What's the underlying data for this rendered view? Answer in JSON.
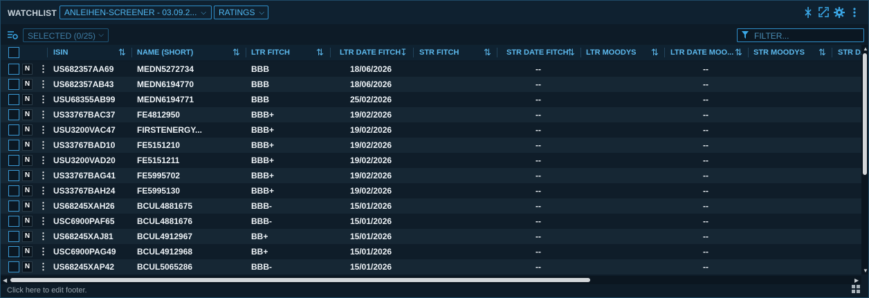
{
  "header": {
    "title": "WATCHLIST",
    "screener_dropdown": "ANLEIHEN-SCREENER - 03.09.2...",
    "view_dropdown": "RATINGS",
    "icons": [
      "pin-icon",
      "expand-icon",
      "gear-icon",
      "more-icon"
    ]
  },
  "toolbar": {
    "selected_label": "SELECTED (0/25)",
    "filter_placeholder": "FILTER..."
  },
  "columns": [
    {
      "label": "ISIN",
      "sort": "both"
    },
    {
      "label": "NAME (SHORT)",
      "sort": "both"
    },
    {
      "label": "LTR FITCH",
      "sort": "both"
    },
    {
      "label": "LTR DATE FITCH",
      "sort": "desc"
    },
    {
      "label": "STR FITCH",
      "sort": "both"
    },
    {
      "label": "STR DATE FITCH",
      "sort": "both"
    },
    {
      "label": "LTR MOODYS",
      "sort": "both"
    },
    {
      "label": "LTR DATE MOO...",
      "sort": "both"
    },
    {
      "label": "STR MOODYS",
      "sort": "both"
    },
    {
      "label": "STR DA",
      "sort": "none"
    }
  ],
  "row_tag": "N",
  "rows": [
    {
      "isin": "US682357AA69",
      "name": "MEDN5272734",
      "ltr_fitch": "BBB",
      "ltr_date_fitch": "18/06/2026",
      "str_fitch": "",
      "str_date_fitch": "--",
      "ltr_moodys": "",
      "ltr_date_moodys": "--",
      "str_moodys": ""
    },
    {
      "isin": "US682357AB43",
      "name": "MEDN6194770",
      "ltr_fitch": "BBB",
      "ltr_date_fitch": "18/06/2026",
      "str_fitch": "",
      "str_date_fitch": "--",
      "ltr_moodys": "",
      "ltr_date_moodys": "--",
      "str_moodys": ""
    },
    {
      "isin": "USU68355AB99",
      "name": "MEDN6194771",
      "ltr_fitch": "BBB",
      "ltr_date_fitch": "25/02/2026",
      "str_fitch": "",
      "str_date_fitch": "--",
      "ltr_moodys": "",
      "ltr_date_moodys": "--",
      "str_moodys": ""
    },
    {
      "isin": "US33767BAC37",
      "name": "FE4812950",
      "ltr_fitch": "BBB+",
      "ltr_date_fitch": "19/02/2026",
      "str_fitch": "",
      "str_date_fitch": "--",
      "ltr_moodys": "",
      "ltr_date_moodys": "--",
      "str_moodys": ""
    },
    {
      "isin": "USU3200VAC47",
      "name": "FIRSTENERGY...",
      "ltr_fitch": "BBB+",
      "ltr_date_fitch": "19/02/2026",
      "str_fitch": "",
      "str_date_fitch": "--",
      "ltr_moodys": "",
      "ltr_date_moodys": "--",
      "str_moodys": ""
    },
    {
      "isin": "US33767BAD10",
      "name": "FE5151210",
      "ltr_fitch": "BBB+",
      "ltr_date_fitch": "19/02/2026",
      "str_fitch": "",
      "str_date_fitch": "--",
      "ltr_moodys": "",
      "ltr_date_moodys": "--",
      "str_moodys": ""
    },
    {
      "isin": "USU3200VAD20",
      "name": "FE5151211",
      "ltr_fitch": "BBB+",
      "ltr_date_fitch": "19/02/2026",
      "str_fitch": "",
      "str_date_fitch": "--",
      "ltr_moodys": "",
      "ltr_date_moodys": "--",
      "str_moodys": ""
    },
    {
      "isin": "US33767BAG41",
      "name": "FE5995702",
      "ltr_fitch": "BBB+",
      "ltr_date_fitch": "19/02/2026",
      "str_fitch": "",
      "str_date_fitch": "--",
      "ltr_moodys": "",
      "ltr_date_moodys": "--",
      "str_moodys": ""
    },
    {
      "isin": "US33767BAH24",
      "name": "FE5995130",
      "ltr_fitch": "BBB+",
      "ltr_date_fitch": "19/02/2026",
      "str_fitch": "",
      "str_date_fitch": "--",
      "ltr_moodys": "",
      "ltr_date_moodys": "--",
      "str_moodys": ""
    },
    {
      "isin": "US68245XAH26",
      "name": "BCUL4881675",
      "ltr_fitch": "BBB-",
      "ltr_date_fitch": "15/01/2026",
      "str_fitch": "",
      "str_date_fitch": "--",
      "ltr_moodys": "",
      "ltr_date_moodys": "--",
      "str_moodys": ""
    },
    {
      "isin": "USC6900PAF65",
      "name": "BCUL4881676",
      "ltr_fitch": "BBB-",
      "ltr_date_fitch": "15/01/2026",
      "str_fitch": "",
      "str_date_fitch": "--",
      "ltr_moodys": "",
      "ltr_date_moodys": "--",
      "str_moodys": ""
    },
    {
      "isin": "US68245XAJ81",
      "name": "BCUL4912967",
      "ltr_fitch": "BB+",
      "ltr_date_fitch": "15/01/2026",
      "str_fitch": "",
      "str_date_fitch": "--",
      "ltr_moodys": "",
      "ltr_date_moodys": "--",
      "str_moodys": ""
    },
    {
      "isin": "USC6900PAG49",
      "name": "BCUL4912968",
      "ltr_fitch": "BB+",
      "ltr_date_fitch": "15/01/2026",
      "str_fitch": "",
      "str_date_fitch": "--",
      "ltr_moodys": "",
      "ltr_date_moodys": "--",
      "str_moodys": ""
    },
    {
      "isin": "US68245XAP42",
      "name": "BCUL5065286",
      "ltr_fitch": "BBB-",
      "ltr_date_fitch": "15/01/2026",
      "str_fitch": "",
      "str_date_fitch": "--",
      "ltr_moodys": "",
      "ltr_date_moodys": "--",
      "str_moodys": ""
    }
  ],
  "footer": {
    "text": "Click here to edit footer."
  },
  "colors": {
    "accent": "#3aa7e6",
    "header_text": "#5cb8ec",
    "row_even": "#162734",
    "row_odd": "#0f1d29"
  }
}
